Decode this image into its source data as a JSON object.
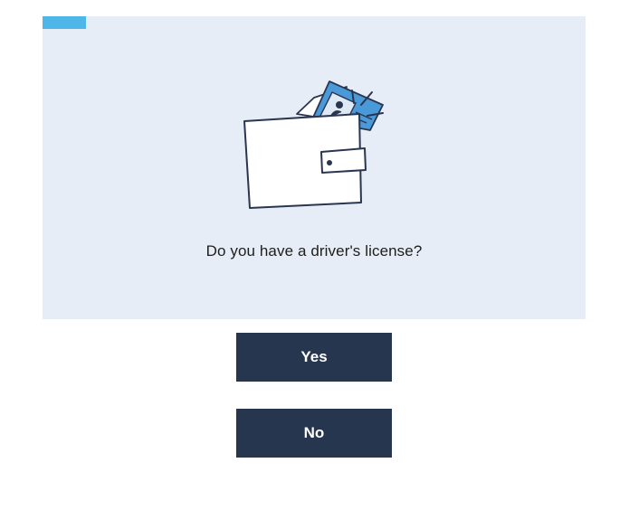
{
  "question": {
    "text": "Do you have a driver's license?",
    "illustration_icon": "wallet-with-id-card-icon"
  },
  "progress": {
    "fraction": 0.08,
    "color": "#4fb6ea"
  },
  "colors": {
    "card_background": "#e7edf6",
    "button_background": "#26364f",
    "button_text": "#ffffff"
  },
  "answers": {
    "yes_label": "Yes",
    "no_label": "No"
  }
}
